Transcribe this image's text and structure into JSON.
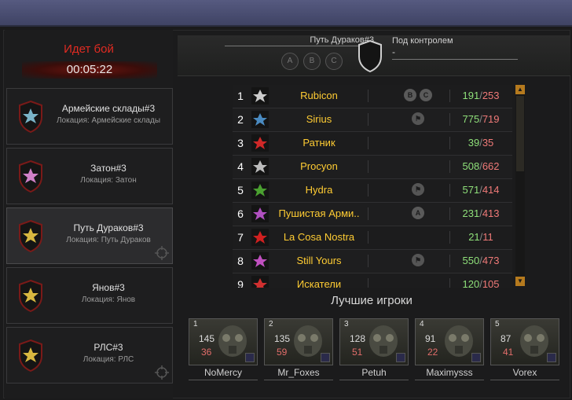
{
  "battle": {
    "status": "Идет бой",
    "timer": "00:05:22"
  },
  "locations": [
    {
      "title": "Армейские склады#3",
      "subtitle": "Локация: Армейские склады",
      "color": "#7ab4c8",
      "active": false
    },
    {
      "title": "Затон#3",
      "subtitle": "Локация: Затон",
      "color": "#d080c8",
      "active": false
    },
    {
      "title": "Путь Дураков#3",
      "subtitle": "Локация: Путь Дураков",
      "color": "#d8b840",
      "active": true
    },
    {
      "title": "Янов#3",
      "subtitle": "Локация: Янов",
      "color": "#d8b840",
      "active": false
    },
    {
      "title": "РЛС#3",
      "subtitle": "Локация: РЛС",
      "color": "#d8b840",
      "active": false
    }
  ],
  "header": {
    "checkpoint_name": "Путь Дураков#3",
    "letters": [
      "A",
      "B",
      "C"
    ],
    "control_label": "Под контролем",
    "control_value": "-"
  },
  "teams": [
    {
      "rank": "1",
      "name": "Rubicon",
      "points": [
        "B",
        "C"
      ],
      "score_a": "191",
      "score_b": "253",
      "emblem_color": "#cccccc"
    },
    {
      "rank": "2",
      "name": "Sirius",
      "points": [
        "flag"
      ],
      "score_a": "775",
      "score_b": "719",
      "emblem_color": "#4a8ac0"
    },
    {
      "rank": "3",
      "name": "Ратник",
      "points": [],
      "score_a": "39",
      "score_b": "35",
      "emblem_color": "#d02828"
    },
    {
      "rank": "4",
      "name": "Procyon",
      "points": [],
      "score_a": "508",
      "score_b": "662",
      "emblem_color": "#bbbbbb"
    },
    {
      "rank": "5",
      "name": "Hydra",
      "points": [
        "flag"
      ],
      "score_a": "571",
      "score_b": "414",
      "emblem_color": "#4aa030"
    },
    {
      "rank": "6",
      "name": "Пушистая Арми..",
      "points": [
        "A"
      ],
      "score_a": "231",
      "score_b": "413",
      "emblem_color": "#b050c0"
    },
    {
      "rank": "7",
      "name": "La Cosa Nostra",
      "points": [],
      "score_a": "21",
      "score_b": "11",
      "emblem_color": "#d02020"
    },
    {
      "rank": "8",
      "name": "Still Yours",
      "points": [
        "flag"
      ],
      "score_a": "550",
      "score_b": "473",
      "emblem_color": "#c050c0"
    },
    {
      "rank": "9",
      "name": "Искатели",
      "points": [],
      "score_a": "120",
      "score_b": "105",
      "emblem_color": "#d03030"
    }
  ],
  "best_players": {
    "title": "Лучшие игроки",
    "players": [
      {
        "place": "1",
        "name": "NoMercy",
        "kills": "145",
        "deaths": "36"
      },
      {
        "place": "2",
        "name": "Mr_Foxes",
        "kills": "135",
        "deaths": "59"
      },
      {
        "place": "3",
        "name": "Petuh",
        "kills": "128",
        "deaths": "51"
      },
      {
        "place": "4",
        "name": "Maximysss",
        "kills": "91",
        "deaths": "22"
      },
      {
        "place": "5",
        "name": "Vorex",
        "kills": "87",
        "deaths": "41"
      }
    ]
  },
  "colors": {
    "accent_red": "#e02b22",
    "team_name": "#ffcc33",
    "score_green": "#8fe07a",
    "score_red": "#f07a78",
    "scroll": "#b57a1e"
  }
}
